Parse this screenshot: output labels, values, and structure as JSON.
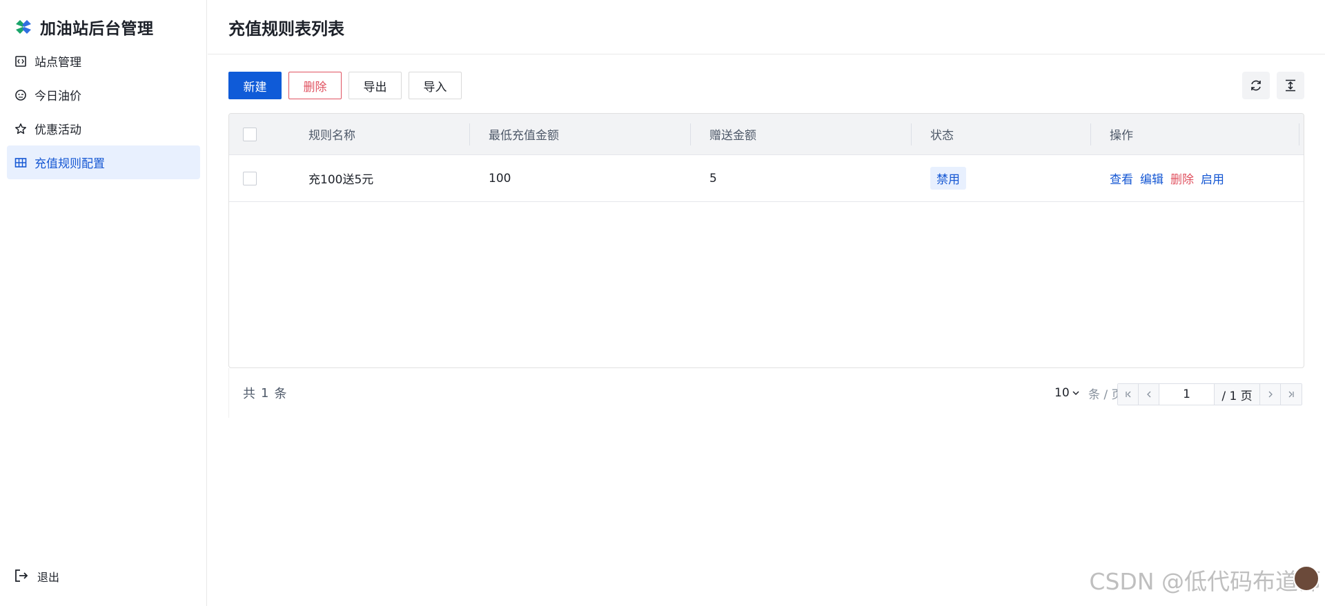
{
  "app": {
    "title": "加油站后台管理"
  },
  "sidebar": {
    "items": [
      {
        "label": "站点管理",
        "icon": "station-icon"
      },
      {
        "label": "今日油价",
        "icon": "fuel-price-icon"
      },
      {
        "label": "优惠活动",
        "icon": "star-icon"
      },
      {
        "label": "充值规则配置",
        "icon": "grid-icon",
        "active": true
      }
    ],
    "logout": "退出"
  },
  "page": {
    "title": "充值规则表列表"
  },
  "toolbar": {
    "new": "新建",
    "delete": "删除",
    "export": "导出",
    "import": "导入"
  },
  "table": {
    "headers": [
      "规则名称",
      "最低充值金额",
      "赠送金额",
      "状态",
      "操作"
    ],
    "rows": [
      {
        "name": "充100送5元",
        "min_amount": "100",
        "bonus": "5",
        "status": "禁用",
        "actions": [
          "查看",
          "编辑",
          "删除",
          "启用"
        ]
      }
    ]
  },
  "pagination": {
    "total_prefix": "共",
    "total": "1",
    "total_suffix": "条",
    "page_size": "10",
    "page_unit": "条 / 页",
    "current_page": "1",
    "total_pages": "/ 1 页"
  },
  "watermark": "CSDN @低代码布道师",
  "colors": {
    "primary": "#0f5bd8",
    "danger": "#e05260",
    "active_bg": "#e8f0fe"
  }
}
